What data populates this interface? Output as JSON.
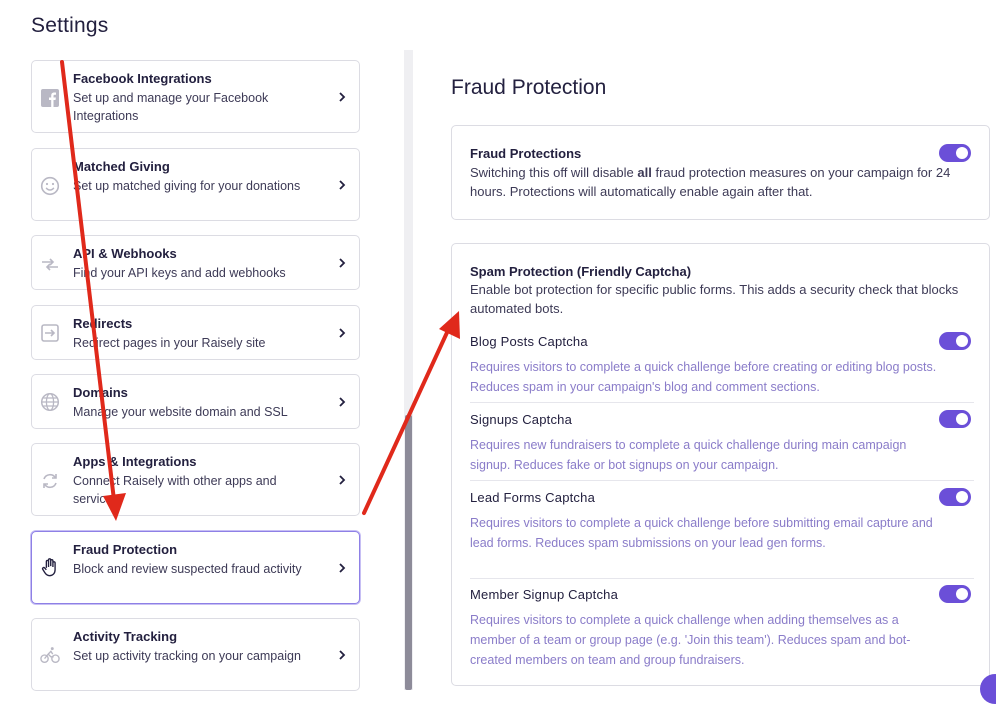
{
  "page": {
    "title": "Settings"
  },
  "settings_list": [
    {
      "title": "Facebook Integrations",
      "desc": "Set up and manage your Facebook Integrations",
      "icon": "facebook-icon"
    },
    {
      "title": "Matched Giving",
      "desc": "Set up matched giving for your donations",
      "icon": "smiley-icon"
    },
    {
      "title": "API & Webhooks",
      "desc": "Find your API keys and add webhooks",
      "icon": "transfer-arrows-icon"
    },
    {
      "title": "Redirects",
      "desc": "Redirect pages in your Raisely site",
      "icon": "redirect-icon"
    },
    {
      "title": "Domains",
      "desc": "Manage your website domain and SSL",
      "icon": "globe-icon"
    },
    {
      "title": "Apps & Integrations",
      "desc": "Connect Raisely with other apps and services",
      "icon": "sync-icon"
    },
    {
      "title": "Fraud Protection",
      "desc": "Block and review suspected fraud activity",
      "icon": "hand-icon"
    },
    {
      "title": "Activity Tracking",
      "desc": "Set up activity tracking on your campaign",
      "icon": "cyclist-icon"
    }
  ],
  "fraud": {
    "section_title": "Fraud Protection",
    "main": {
      "title": "Fraud Protections",
      "text_before": "Switching this off will disable ",
      "text_bold": "all",
      "text_after": " fraud protection measures on your campaign for 24 hours. Protections will automatically enable again after that.",
      "enabled": true
    },
    "spam": {
      "title": "Spam Protection (Friendly Captcha)",
      "text": "Enable bot protection for specific public forms. This adds a security check that blocks automated bots.",
      "options": [
        {
          "title": "Blog Posts Captcha",
          "desc": "Requires visitors to complete a quick challenge before creating or editing blog posts. Reduces spam in your campaign's blog and comment sections.",
          "enabled": true
        },
        {
          "title": "Signups Captcha",
          "desc": "Requires new fundraisers to complete a quick challenge during main campaign signup. Reduces fake or bot signups on your campaign.",
          "enabled": true
        },
        {
          "title": "Lead Forms Captcha",
          "desc": "Requires visitors to complete a quick challenge before submitting email capture and lead forms. Reduces spam submissions on your lead gen forms.",
          "enabled": true
        },
        {
          "title": "Member Signup Captcha",
          "desc": "Requires visitors to complete a quick challenge when adding themselves as a member of a team or group page (e.g. 'Join this team'). Reduces spam and bot-created members on team and group fundraisers.",
          "enabled": true
        }
      ]
    }
  },
  "colors": {
    "accent": "#6b4fd8",
    "annotation_arrow": "#e0291b",
    "muted_text": "#8a7cc9"
  }
}
